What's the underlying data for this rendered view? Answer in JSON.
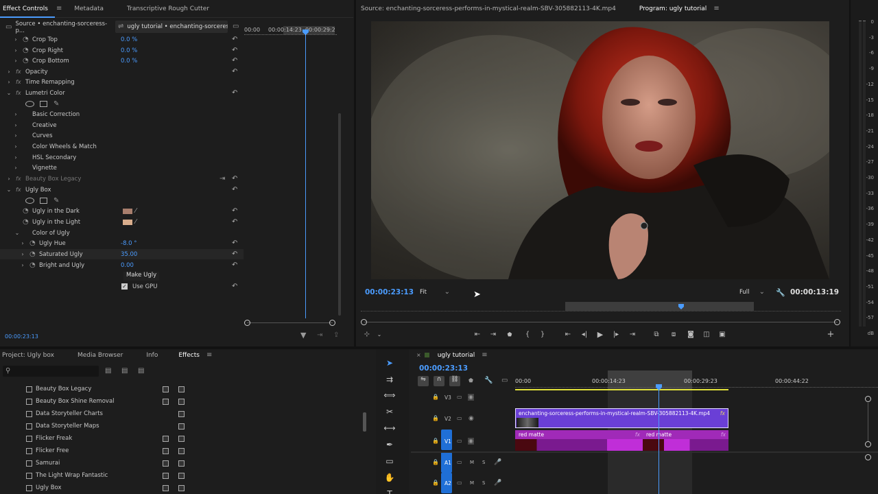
{
  "top_tabs": {
    "effect_controls": "Effect Controls",
    "metadata": "Metadata",
    "transcriptive": "Transcriptive Rough Cutter"
  },
  "ec": {
    "source_label": "Source • enchanting-sorceress-p...",
    "seq_label": "ugly tutorial • enchanting-sorceress...",
    "mini_times": [
      "00:00",
      "00:00:14:23",
      "00:00:29:2"
    ],
    "current_time": "00:00:23:13",
    "rows": [
      {
        "label": "Crop Top",
        "value": "0.0 %"
      },
      {
        "label": "Crop Right",
        "value": "0.0 %"
      },
      {
        "label": "Crop Bottom",
        "value": "0.0 %"
      },
      {
        "label": "Opacity"
      },
      {
        "label": "Time Remapping"
      },
      {
        "label": "Lumetri Color"
      },
      {
        "label": "Basic Correction"
      },
      {
        "label": "Creative"
      },
      {
        "label": "Curves"
      },
      {
        "label": "Color Wheels & Match"
      },
      {
        "label": "HSL Secondary"
      },
      {
        "label": "Vignette"
      },
      {
        "label": "Beauty Box Legacy"
      },
      {
        "label": "Ugly Box"
      },
      {
        "label": "Ugly in the Dark"
      },
      {
        "label": "Ugly in the Light"
      },
      {
        "label": "Color of Ugly"
      },
      {
        "label": "Ugly Hue",
        "value": "-8.0 °"
      },
      {
        "label": "Saturated Ugly",
        "value": "35.00"
      },
      {
        "label": "Bright and Ugly",
        "value": "0.00"
      }
    ],
    "make_ugly": "Make Ugly",
    "use_gpu": "Use GPU",
    "swatch_dark": "#a87e6d",
    "swatch_light": "#d9ad8c"
  },
  "source_monitor": {
    "title": "Source: enchanting-sorceress-performs-in-mystical-realm-SBV-305882113-4K.mp4",
    "program_label": "Program: ugly tutorial",
    "timecode": "00:00:23:13",
    "fit": "Fit",
    "full": "Full",
    "duration": "00:00:13:19"
  },
  "meter": {
    "labels": [
      "0",
      "-3",
      "-6",
      "-9",
      "-12",
      "-15",
      "-18",
      "-21",
      "-24",
      "-27",
      "-30",
      "-33",
      "-36",
      "-39",
      "-42",
      "-45",
      "-48",
      "-51",
      "-54",
      "-57",
      "dB"
    ]
  },
  "project": {
    "tabs": [
      "Project: Ugly box",
      "Media Browser",
      "Info",
      "Effects"
    ],
    "effects": [
      "Beauty Box Legacy",
      "Beauty Box Shine Removal",
      "Data Storyteller Charts",
      "Data Storyteller Maps",
      "Flicker Freak",
      "Flicker Free",
      "Samurai",
      "The Light Wrap Fantastic",
      "Ugly Box"
    ]
  },
  "timeline": {
    "tab": "ugly tutorial",
    "timecode": "00:00:23:13",
    "ruler": [
      "00:00",
      "00:00:14:23",
      "00:00:29:23",
      "00:00:44:22"
    ],
    "tracks": [
      "V3",
      "V2",
      "V1",
      "A1",
      "A2"
    ],
    "track_m": "M",
    "track_s": "S",
    "v2_clip": "enchanting-sorceress-performs-in-mystical-realm-SBV-305882113-4K.mp4",
    "v1_clip_a": "red matte",
    "v1_clip_b": "red matte",
    "fx": "fx"
  },
  "colors": {
    "accent": "#4b9cff",
    "v2_clip": "#6a3fd6",
    "v1_clip": "#a02ab8",
    "track_active": "#1f6fd6"
  }
}
